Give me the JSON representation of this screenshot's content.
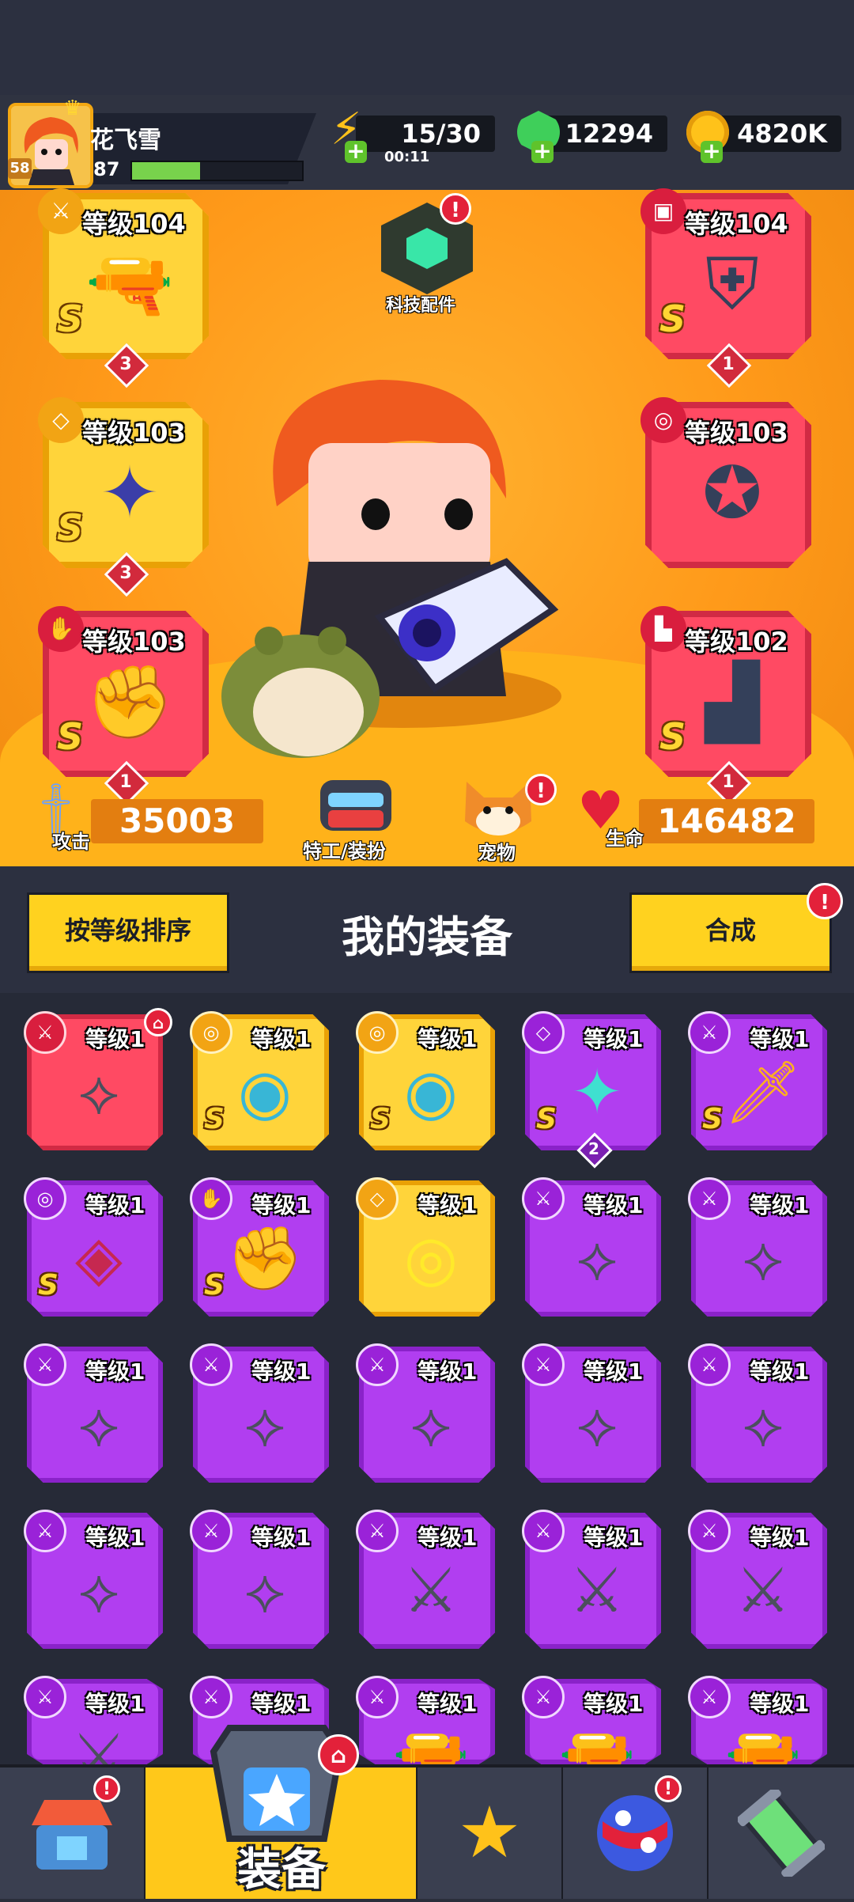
{
  "player": {
    "name": "花飞雪",
    "account_level": "58",
    "xp_level": "87",
    "xp_fraction": 0.4
  },
  "resources": {
    "energy": "15/30",
    "energy_timer": "00:11",
    "gems": "12294",
    "gold": "4820K"
  },
  "hero": {
    "tech_parts_label": "科技配件",
    "slots_left": [
      {
        "level": "等级104",
        "rank": "S",
        "stars": "3",
        "type_icon": "weapon-icon",
        "item": "blaster-gun",
        "rarity": "gold"
      },
      {
        "level": "等级103",
        "rank": "S",
        "stars": "3",
        "type_icon": "necklace-icon",
        "item": "star-necklace",
        "rarity": "gold"
      },
      {
        "level": "等级103",
        "rank": "S",
        "stars": "1",
        "type_icon": "glove-icon",
        "item": "mech-gauntlet",
        "rarity": "red"
      }
    ],
    "slots_right": [
      {
        "level": "等级104",
        "rank": "S",
        "stars": "1",
        "type_icon": "armor-icon",
        "item": "mech-armor",
        "rarity": "red"
      },
      {
        "level": "等级103",
        "rank": "",
        "stars": "",
        "type_icon": "belt-icon",
        "item": "star-belt",
        "rarity": "red"
      },
      {
        "level": "等级102",
        "rank": "S",
        "stars": "1",
        "type_icon": "boot-icon",
        "item": "mech-boot",
        "rarity": "red"
      }
    ],
    "attack_label": "攻击",
    "attack_value": "35003",
    "agent_label": "特工/装扮",
    "pet_label": "宠物",
    "hp_label": "生命",
    "hp_value": "146482"
  },
  "inventory": {
    "sort_button": "按等级排序",
    "title": "我的装备",
    "merge_button": "合成",
    "items": [
      {
        "level": "等级1",
        "rank": "",
        "rarity": "red",
        "type_icon": "weapon-icon",
        "item": "kunai",
        "stars": ""
      },
      {
        "level": "等级1",
        "rank": "S",
        "rarity": "gold",
        "type_icon": "belt-icon",
        "item": "gold-belt",
        "stars": ""
      },
      {
        "level": "等级1",
        "rank": "S",
        "rarity": "gold",
        "type_icon": "belt-icon",
        "item": "gold-belt",
        "stars": ""
      },
      {
        "level": "等级1",
        "rank": "S",
        "rarity": "purple",
        "type_icon": "necklace-icon",
        "item": "star-necklace",
        "stars": "2"
      },
      {
        "level": "等级1",
        "rank": "S",
        "rarity": "purple",
        "type_icon": "weapon-icon",
        "item": "flame-sword",
        "stars": ""
      },
      {
        "level": "等级1",
        "rank": "S",
        "rarity": "purple",
        "type_icon": "belt-icon",
        "item": "ruby-belt",
        "stars": ""
      },
      {
        "level": "等级1",
        "rank": "S",
        "rarity": "purple",
        "type_icon": "glove-icon",
        "item": "claw-glove",
        "stars": ""
      },
      {
        "level": "等级1",
        "rank": "",
        "rarity": "gold",
        "type_icon": "necklace-icon",
        "item": "spiked-collar",
        "stars": ""
      },
      {
        "level": "等级1",
        "rank": "",
        "rarity": "purple",
        "type_icon": "weapon-icon",
        "item": "kunai",
        "stars": ""
      },
      {
        "level": "等级1",
        "rank": "",
        "rarity": "purple",
        "type_icon": "weapon-icon",
        "item": "kunai",
        "stars": ""
      },
      {
        "level": "等级1",
        "rank": "",
        "rarity": "purple",
        "type_icon": "weapon-icon",
        "item": "kunai",
        "stars": ""
      },
      {
        "level": "等级1",
        "rank": "",
        "rarity": "purple",
        "type_icon": "weapon-icon",
        "item": "kunai",
        "stars": ""
      },
      {
        "level": "等级1",
        "rank": "",
        "rarity": "purple",
        "type_icon": "weapon-icon",
        "item": "kunai",
        "stars": ""
      },
      {
        "level": "等级1",
        "rank": "",
        "rarity": "purple",
        "type_icon": "weapon-icon",
        "item": "kunai",
        "stars": ""
      },
      {
        "level": "等级1",
        "rank": "",
        "rarity": "purple",
        "type_icon": "weapon-icon",
        "item": "kunai",
        "stars": ""
      },
      {
        "level": "等级1",
        "rank": "",
        "rarity": "purple",
        "type_icon": "weapon-icon",
        "item": "kunai",
        "stars": ""
      },
      {
        "level": "等级1",
        "rank": "",
        "rarity": "purple",
        "type_icon": "weapon-icon",
        "item": "kunai",
        "stars": ""
      },
      {
        "level": "等级1",
        "rank": "",
        "rarity": "purple",
        "type_icon": "weapon-icon",
        "item": "katana",
        "stars": ""
      },
      {
        "level": "等级1",
        "rank": "",
        "rarity": "purple",
        "type_icon": "weapon-icon",
        "item": "katana",
        "stars": ""
      },
      {
        "level": "等级1",
        "rank": "",
        "rarity": "purple",
        "type_icon": "weapon-icon",
        "item": "katana",
        "stars": ""
      },
      {
        "level": "等级1",
        "rank": "",
        "rarity": "purple",
        "type_icon": "weapon-icon",
        "item": "katana",
        "stars": ""
      },
      {
        "level": "等级1",
        "rank": "",
        "rarity": "purple",
        "type_icon": "weapon-icon",
        "item": "blaster",
        "stars": ""
      },
      {
        "level": "等级1",
        "rank": "",
        "rarity": "purple",
        "type_icon": "weapon-icon",
        "item": "revolver",
        "stars": ""
      },
      {
        "level": "等级1",
        "rank": "",
        "rarity": "purple",
        "type_icon": "weapon-icon",
        "item": "revolver",
        "stars": ""
      },
      {
        "level": "等级1",
        "rank": "",
        "rarity": "purple",
        "type_icon": "weapon-icon",
        "item": "shotgun",
        "stars": ""
      }
    ]
  },
  "nav": {
    "equipment_label": "装备",
    "tabs": [
      "shop-icon",
      "equipment-icon",
      "battle-icon",
      "planet-icon",
      "dna-icon"
    ]
  },
  "colors": {
    "hero_bg": "#ff9a1a",
    "purple_rarity": "#b13ef0",
    "gold_rarity": "#ffd43a",
    "red_rarity": "#ff4a63",
    "alert": "#e3213a"
  }
}
